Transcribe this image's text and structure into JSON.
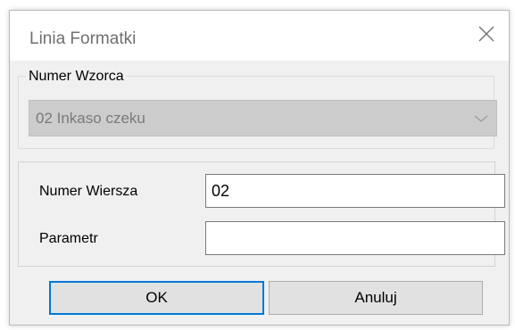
{
  "window": {
    "title": "Linia Formatki",
    "close_icon": "close-icon"
  },
  "pattern_group": {
    "legend": "Numer Wzorca",
    "selected_value": "02 Inkaso czeku",
    "enabled": false,
    "dropdown_icon": "chevron-down-icon"
  },
  "fields": {
    "row_number_label": "Numer Wiersza",
    "row_number_value": "02",
    "parameter_label": "Parametr",
    "parameter_value": ""
  },
  "buttons": {
    "ok_label": "OK",
    "cancel_label": "Anuluj"
  },
  "colors": {
    "focus_accent": "#0078d7",
    "dialog_background": "#f0f0f0",
    "disabled_combo": "#cccccc"
  }
}
